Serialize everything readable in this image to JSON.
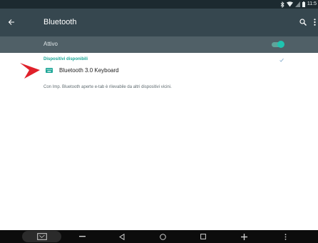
{
  "status_bar": {
    "time": "11:5",
    "icons": [
      "bluetooth-icon",
      "wifi-icon",
      "signal-icon",
      "battery-icon"
    ]
  },
  "app_bar": {
    "title": "Bluetooth",
    "icons": [
      "back-arrow-icon",
      "search-icon",
      "more-vert-icon"
    ]
  },
  "master_switch": {
    "label": "Attivo",
    "state": "on"
  },
  "section": {
    "header": "Dispositivi disponibili"
  },
  "devices": [
    {
      "name": "Bluetooth 3.0 Keyboard",
      "icon": "keyboard-icon"
    }
  ],
  "info": {
    "text": "Con Imp. Bluetooth aperte e-tab è rilevabile da altri dispositivi vicini."
  },
  "nav_bar": {
    "buttons": [
      "screenshot-icon",
      "volume-down-icon",
      "back-icon",
      "home-icon",
      "recents-icon",
      "volume-up-icon",
      "menu-icon"
    ]
  },
  "colors": {
    "status_bar": "#1c2a30",
    "app_bar": "#36474f",
    "switch_bar": "#506067",
    "accent": "#1aa596",
    "arrow": "#e0202a",
    "nav_bar": "#0c0c0c"
  }
}
